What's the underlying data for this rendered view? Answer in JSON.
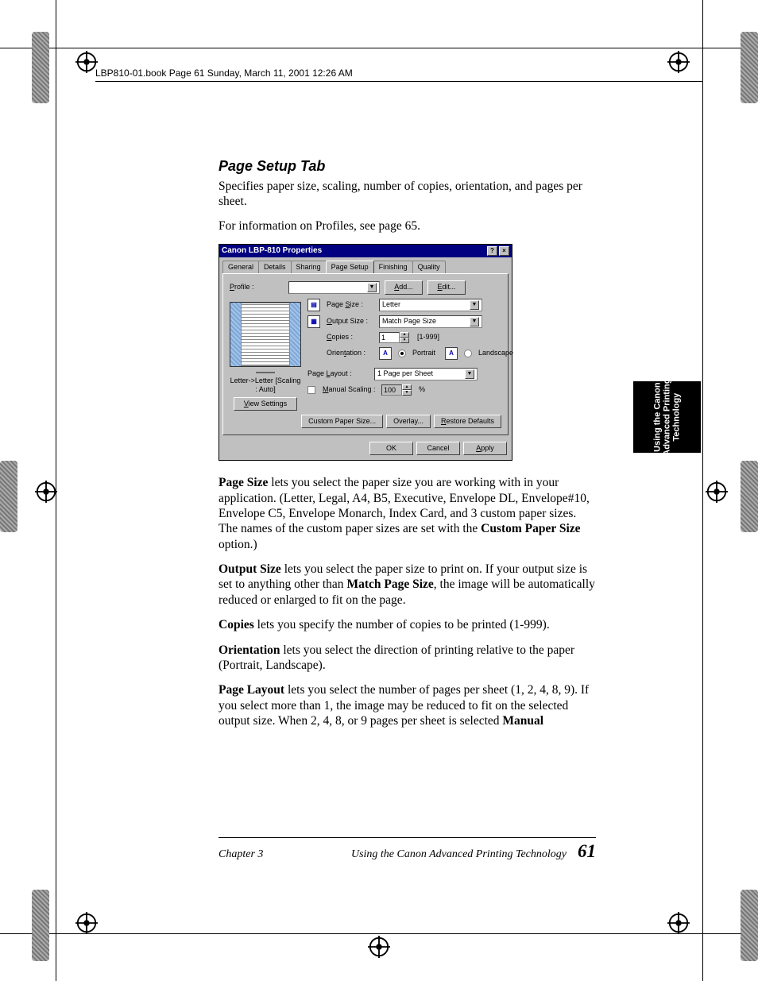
{
  "header_text": "LBP810-01.book  Page 61  Sunday, March 11, 2001  12:26 AM",
  "heading": "Page Setup Tab",
  "intro": "Specifies paper size, scaling, number of copies, orientation, and pages per sheet.",
  "profiles_ref": "For information on Profiles, see page 65.",
  "ui": {
    "title": "Canon LBP-810 Properties",
    "help_btn": "?",
    "close_btn": "×",
    "tabs": [
      "General",
      "Details",
      "Sharing",
      "Page Setup",
      "Finishing",
      "Quality"
    ],
    "active_tab": "Page Setup",
    "profile_label": "Profile :",
    "add_btn": "Add...",
    "edit_btn": "Edit...",
    "page_size_label": "Page Size :",
    "page_size_value": "Letter",
    "output_size_label": "Output Size :",
    "output_size_value": "Match Page Size",
    "copies_label": "Copies :",
    "copies_value": "1",
    "copies_range": "[1-999]",
    "orientation_label": "Orientation :",
    "portrait_label": "Portrait",
    "landscape_label": "Landscape",
    "orientation_icon": "A",
    "page_layout_label": "Page Layout :",
    "page_layout_value": "1 Page per Sheet",
    "manual_scaling_label": "Manual Scaling :",
    "manual_scaling_value": "100",
    "manual_scaling_unit": "%",
    "status_text": "Letter->Letter [Scaling : Auto]",
    "view_settings_btn": "View Settings",
    "custom_paper_btn": "Custom Paper Size...",
    "overlay_btn": "Overlay...",
    "restore_btn": "Restore Defaults",
    "ok_btn": "OK",
    "cancel_btn": "Cancel",
    "apply_btn": "Apply"
  },
  "body": {
    "p1a": "Page Size",
    "p1b": " lets you select the paper size you are working with in your application. (Letter, Legal, A4, B5, Executive, Envelope DL, Envelope#10, Envelope C5, Envelope Monarch, Index Card, and 3 custom paper sizes. The names of the custom paper sizes are set with the ",
    "p1c": "Custom Paper Size",
    "p1d": " option.)",
    "p2a": "Output Size",
    "p2b": " lets you select the paper size to print on. If your output size is set to anything other than ",
    "p2c": "Match Page Size",
    "p2d": ", the image will be automatically reduced or enlarged to fit on the page.",
    "p3a": "Copies",
    "p3b": " lets you specify the number of copies to be printed (1-999).",
    "p4a": "Orientation",
    "p4b": " lets you select the direction of printing relative to the paper (Portrait, Landscape).",
    "p5a": "Page Layout",
    "p5b": " lets you select the number of pages per sheet (1, 2, 4, 8, 9). If you select more than 1, the image may be reduced to fit on the selected output size. When 2, 4, 8, or 9 pages per sheet is selected ",
    "p5c": "Manual"
  },
  "sidetab": "Using the Canon\nAdvanced Printing\nTechnology",
  "footer": {
    "chapter": "Chapter 3",
    "title": "Using the Canon Advanced Printing Technology",
    "page": "61"
  }
}
